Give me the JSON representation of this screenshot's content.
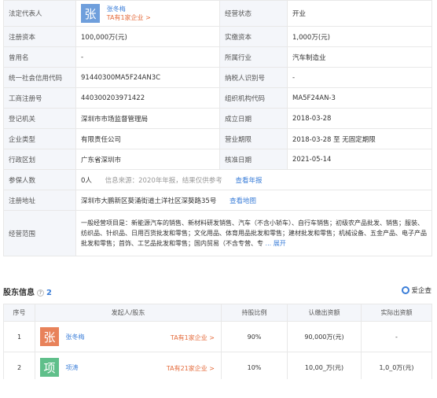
{
  "info": {
    "legal_rep_label": "法定代表人",
    "legal_rep_avatar": "张",
    "legal_rep_name": "张冬梅",
    "legal_rep_tag": "TA有1家企业 >",
    "status_label": "经营状态",
    "status_value": "开业",
    "reg_capital_label": "注册资本",
    "reg_capital_value": "100,000万(元)",
    "paid_capital_label": "实缴资本",
    "paid_capital_value": "1,000万(元)",
    "former_name_label": "曾用名",
    "former_name_value": "-",
    "industry_label": "所属行业",
    "industry_value": "汽车制造业",
    "credit_code_label": "统一社会信用代码",
    "credit_code_value": "91440300MA5F24AN3C",
    "taxpayer_label": "纳税人识别号",
    "taxpayer_value": "-",
    "biz_reg_label": "工商注册号",
    "biz_reg_value": "440300203971422",
    "org_code_label": "组织机构代码",
    "org_code_value": "MA5F24AN-3",
    "authority_label": "登记机关",
    "authority_value": "深圳市市场监督管理局",
    "founded_label": "成立日期",
    "founded_value": "2018-03-28",
    "type_label": "企业类型",
    "type_value": "有限责任公司",
    "term_label": "营业期限",
    "term_value": "2018-03-28 至 无固定期限",
    "region_label": "行政区划",
    "region_value": "广东省深圳市",
    "approval_label": "核准日期",
    "approval_value": "2021-05-14",
    "insured_label": "参保人数",
    "insured_value": "0人",
    "insured_source": "信息来源：2020年年报，结果仅供参考",
    "insured_link": "查看年报",
    "address_label": "注册地址",
    "address_value": "深圳市大鹏新区葵涌街道土洋社区深葵路35号",
    "address_link": "查看地图",
    "scope_label": "经营范围",
    "scope_value": "一般经营项目是：新能源汽车的销售、新材料研发销售、汽车（不含小轿车）、自行车销售；初级农产品批发、销售；服装、纺织品、针织品、日用百货批发和零售；文化用品、体育用品批发和零售；建材批发和零售；机械设备、五金产品、电子产品批发和零售；首饰、工艺品批发和零售；国内贸易（不含专营、专",
    "scope_more": "... 展开"
  },
  "shareholders": {
    "title": "股东信息",
    "help": "?",
    "count": "2",
    "brand": "爱企查",
    "columns": [
      "序号",
      "发起人/股东",
      "持股比例",
      "认缴出资额",
      "实际出资额"
    ],
    "rows": [
      {
        "no": "1",
        "avatar": "张",
        "avatar_color": "#e8825a",
        "name": "张冬梅",
        "tag": "TA有1家企业 >",
        "ratio": "90%",
        "subscribed": "90,000万(元)",
        "actual": "-"
      },
      {
        "no": "2",
        "avatar": "项",
        "avatar_color": "#5fbf8a",
        "name": "项涛",
        "tag": "TA有21家企业 >",
        "ratio": "10%",
        "subscribed": "10,00_万(元)",
        "actual": "1,0_0万(元)"
      }
    ]
  }
}
